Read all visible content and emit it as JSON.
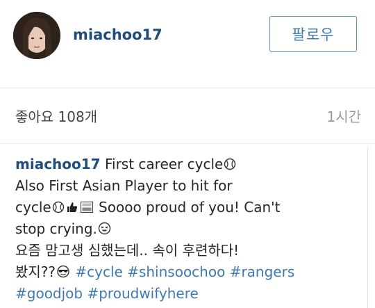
{
  "post": {
    "username": "miachoo17",
    "follow_label": "팔로우"
  },
  "stats": {
    "likes_label": "좋아요 108개",
    "time_ago": "1시간"
  },
  "caption": {
    "username": "miachoo17",
    "line1_text": " First career cycle",
    "line2_text": "Also First Asian Player to hit for",
    "line3_prefix": "cycle",
    "line3_text": " Soooo proud of you! Can't",
    "line4_text": "stop crying.",
    "line5_text": "요즘 맘고생 심했는데.. 속이 후련하다!",
    "line6_prefix": "봤지??",
    "hashtags": [
      "#cycle",
      "#shinsoochoo",
      "#rangers",
      "#goodjob",
      "#proudwifyhere"
    ]
  },
  "icons": {
    "baseball": "baseball-emoji-icon",
    "thumbs": "thumbs-up-emoji-icon",
    "gif": "gif-box-icon",
    "laugh": "crying-laughing-emoji-icon",
    "cool": "sunglasses-emoji-icon"
  }
}
